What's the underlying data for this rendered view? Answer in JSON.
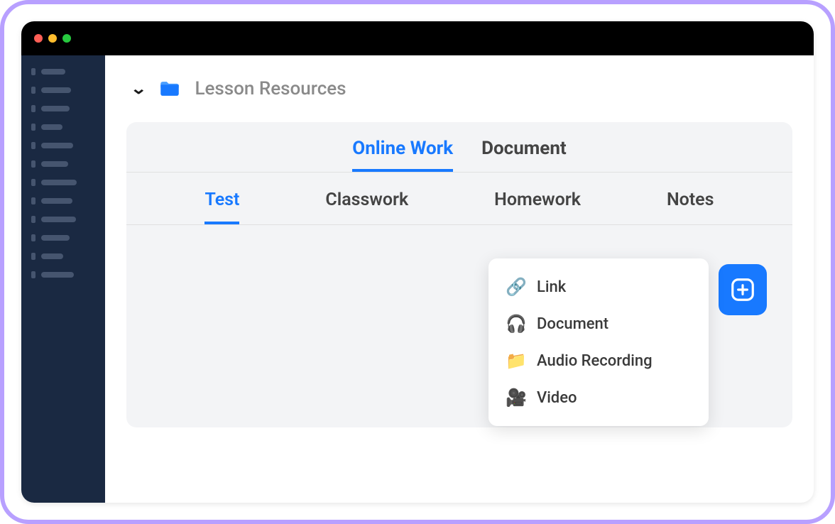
{
  "header": {
    "title": "Lesson Resources"
  },
  "tabs": {
    "primary": [
      {
        "label": "Online Work",
        "active": true
      },
      {
        "label": "Document",
        "active": false
      }
    ],
    "secondary": [
      {
        "label": "Test",
        "active": true
      },
      {
        "label": "Classwork",
        "active": false
      },
      {
        "label": "Homework",
        "active": false
      },
      {
        "label": "Notes",
        "active": false
      }
    ]
  },
  "dropdown": {
    "items": [
      {
        "emoji": "🔗",
        "label": "Link"
      },
      {
        "emoji": "🎧",
        "label": "Document"
      },
      {
        "emoji": "📁",
        "label": "Audio Recording"
      },
      {
        "emoji": "🎥",
        "label": "Video"
      }
    ]
  },
  "sidebar": {
    "items": [
      34,
      42,
      40,
      30,
      45,
      38,
      50,
      44,
      49,
      40,
      31,
      46
    ]
  },
  "colors": {
    "accent": "#1879ff",
    "frame": "#b8a0ff",
    "sidebar": "#1a2942"
  }
}
